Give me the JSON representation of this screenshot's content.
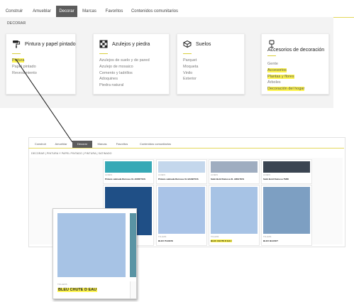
{
  "top_nav": {
    "tabs": [
      "Construir",
      "Amueblar",
      "Decorar",
      "Marcas",
      "Favoritos",
      "Contenidos comunitarios"
    ],
    "active_tab": "Decorar"
  },
  "top_breadcrumb": "DECORAR",
  "categories": [
    {
      "title": "Pintura y papel pintado",
      "icon": "paint-roller-icon",
      "items": [
        "Pintura",
        "Papel pintado",
        "Revestimiento"
      ],
      "highlighted": [
        0
      ]
    },
    {
      "title": "Azulejos y piedra",
      "icon": "tiles-icon",
      "items": [
        "Azulejos de suelo y de pared",
        "Azulejo de mosaico",
        "Cemento y ladrillos",
        "Adoquines",
        "Piedra natural"
      ],
      "highlighted": []
    },
    {
      "title": "Suelos",
      "icon": "floor-icon",
      "items": [
        "Parquet",
        "Moqueta",
        "Vinilo",
        "Exterior"
      ],
      "highlighted": []
    },
    {
      "title": "Accesorios de decoración",
      "icon": "lamp-icon",
      "items": [
        "Gente",
        "Accesorios",
        "Plantas y flores",
        "Árboles",
        "Decoración del hogar"
      ],
      "highlighted": [
        1,
        2,
        4
      ]
    }
  ],
  "bottom": {
    "tabs": [
      "Construir",
      "Amueblar",
      "Decorar",
      "Marcas",
      "Favoritos",
      "Contenidos comunitarios"
    ],
    "active_tab": "Decorar",
    "breadcrumbs": "DECORAR  |  PINTURA Y PAPEL PINTADO  |  PINTURA  |  SATINADO",
    "row1": [
      {
        "brand": "LUXENS",
        "name": "Pintura satinada Ruinosa XL AFRIFTICS",
        "color": "#36a9b6"
      },
      {
        "brand": "LUXENS",
        "name": "Pintura satinada Ruinosa XL BASETICS",
        "color": "#c4d7ec"
      },
      {
        "brand": "LUXENS",
        "name": "Satin Bold Ruinosa XL ARIGTICS",
        "color": "#9fadc0"
      },
      {
        "brand": "LUXENS",
        "name": "Satin Bold Ruinosa 75/88",
        "color": "#3b4552"
      }
    ],
    "row2": [
      {
        "brand": "",
        "name": "",
        "color": "#1f4f86"
      },
      {
        "brand": "TOLLENS",
        "name": "BLEU PLEEVE",
        "color": "#a9c3e7"
      },
      {
        "brand": "TOLLENS",
        "name": "BLEU CHUTE D EAU",
        "color": "#a7c3e5",
        "highlight": true
      },
      {
        "brand": "TOLLENS",
        "name": "BLEU BLEUET",
        "color": "#7d9fc2"
      }
    ]
  },
  "zoom": {
    "brand": "TOLLENS",
    "name": "BLEU CHUTE D EAU"
  },
  "colors": {
    "highlight": "#fdf44e",
    "nav_active": "#5c5c5c",
    "accent_rule": "#d9cf3a"
  }
}
